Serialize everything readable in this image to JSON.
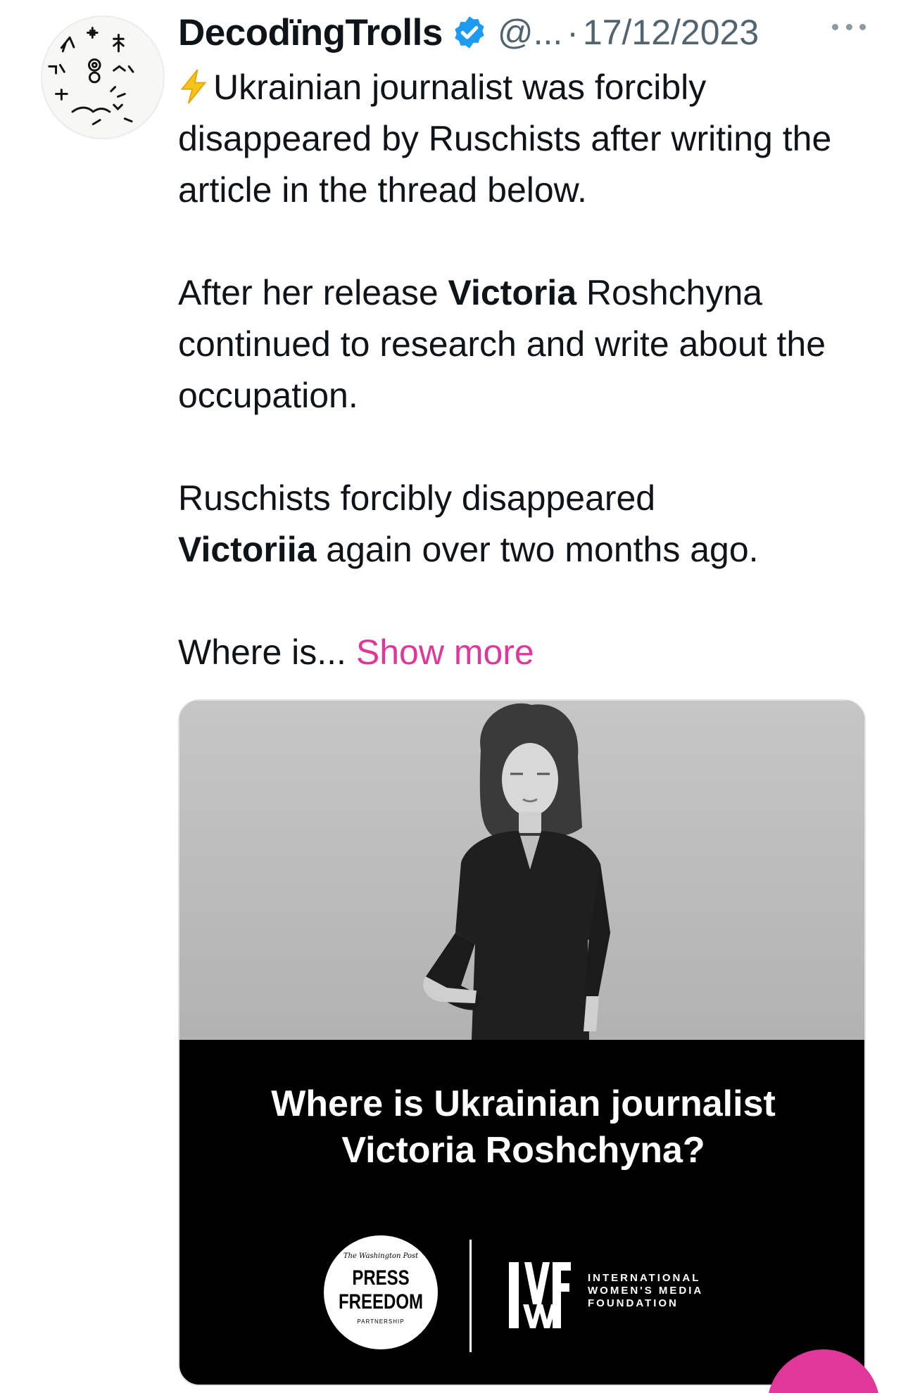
{
  "author": {
    "display_name": "DecodïngTrolls",
    "handle": "@...",
    "separator": "·",
    "date": "17/12/2023"
  },
  "tweet": {
    "line1": "Ukrainian journalist was forcibly disappeared by Ruschists after writing the article in the thread below.",
    "p2_before": "After her release ",
    "p2_bold": "Victoria",
    "p2_after": " Roshchyna continued to research and write about the occupation.",
    "p3_before": "Ruschists forcibly disappeared ",
    "p3_bold": "Victoriia",
    "p3_after": " again over two months ago.",
    "p4_truncated": "Where is...",
    "show_more": "Show more"
  },
  "media": {
    "headline_line1": "Where is Ukrainian journalist",
    "headline_line2": "Victoria Roshchyna?",
    "press_masthead": "The Washington Post",
    "press_line1": "PRESS",
    "press_line2": "FREEDOM",
    "press_small": "PARTNERSHIP",
    "iwmf_line1": "INTERNATIONAL",
    "iwmf_line2": "WOMEN'S MEDIA",
    "iwmf_line3": "FOUNDATION"
  },
  "colors": {
    "accent_link": "#e0389a",
    "verified_blue": "#1d9bf0",
    "muted": "#536471"
  },
  "icons": [
    "avatar",
    "verified-badge-icon",
    "more-options-icon",
    "lightning-emoji-icon",
    "iwmf-logo-icon"
  ]
}
